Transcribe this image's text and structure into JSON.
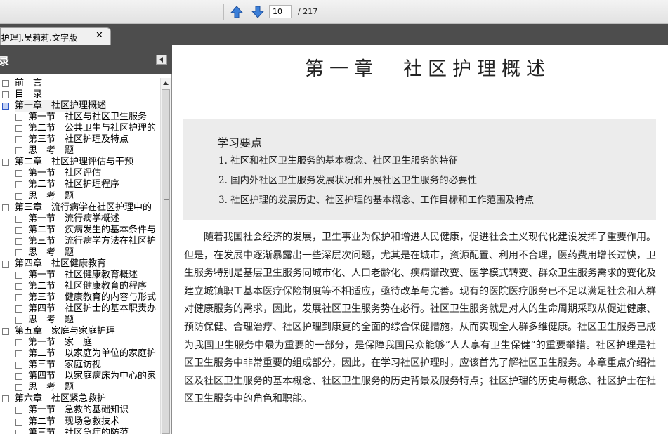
{
  "toolbar": {
    "page_current": "10",
    "page_total": "/ 217"
  },
  "tab": {
    "title": "[护理].吴莉莉.文字版",
    "close": "✕"
  },
  "toc": {
    "header": "录",
    "items": [
      {
        "label": "前　言",
        "level": 0
      },
      {
        "label": "目　录",
        "level": 0
      },
      {
        "label": "第一章　社区护理概述",
        "level": 0,
        "active": true
      },
      {
        "label": "第一节　社区与社区卫生服务",
        "level": 1
      },
      {
        "label": "第二节　公共卫生与社区护理的",
        "level": 1
      },
      {
        "label": "第三节　社区护理及特点",
        "level": 1
      },
      {
        "label": "思　考　题",
        "level": 1
      },
      {
        "label": "第二章　社区护理评估与干预",
        "level": 0
      },
      {
        "label": "第一节　社区评估",
        "level": 1
      },
      {
        "label": "第二节　社区护理程序",
        "level": 1
      },
      {
        "label": "思　考　题",
        "level": 1
      },
      {
        "label": "第三章　流行病学在社区护理中的",
        "level": 0
      },
      {
        "label": "第一节　流行病学概述",
        "level": 1
      },
      {
        "label": "第二节　疾病发生的基本条件与",
        "level": 1
      },
      {
        "label": "第三节　流行病学方法在社区护",
        "level": 1
      },
      {
        "label": "思　考　题",
        "level": 1
      },
      {
        "label": "第四章　社区健康教育",
        "level": 0
      },
      {
        "label": "第一节　社区健康教育概述",
        "level": 1
      },
      {
        "label": "第二节　社区健康教育的程序",
        "level": 1
      },
      {
        "label": "第三节　健康教育的内容与形式",
        "level": 1
      },
      {
        "label": "第四节　社区护士的基本职责办",
        "level": 1
      },
      {
        "label": "思　考　题",
        "level": 1
      },
      {
        "label": "第五章　家庭与家庭护理",
        "level": 0
      },
      {
        "label": "第一节　家　庭",
        "level": 1
      },
      {
        "label": "第二节　以家庭为单位的家庭护",
        "level": 1
      },
      {
        "label": "第三节　家庭访视",
        "level": 1
      },
      {
        "label": "第四节　以家庭病床为中心的家",
        "level": 1
      },
      {
        "label": "思　考　题",
        "level": 1
      },
      {
        "label": "第六章　社区紧急救护",
        "level": 0
      },
      {
        "label": "第一节　急救的基础知识",
        "level": 1
      },
      {
        "label": "第二节　现场急救技术",
        "level": 1
      },
      {
        "label": "第三节　社区急症的防范",
        "level": 1
      }
    ]
  },
  "document": {
    "chapter_title": "第一章　社区护理概述",
    "key_points_title": "学习要点",
    "key_points": [
      "1. 社区和社区卫生服务的基本概念、社区卫生服务的特征",
      "2. 国内外社区卫生服务发展状况和开展社区卫生服务的必要性",
      "3. 社区护理的发展历史、社区护理的基本概念、工作目标和工作范围及特点"
    ],
    "paragraph": "随着我国社会经济的发展，卫生事业为保护和增进人民健康，促进社会主义现代化建设发挥了重要作用。但是，在发展中逐渐暴露出一些深层次问题，尤其是在城市，资源配置、利用不合理，医药费用增长过快，卫生服务特别是基层卫生服务同城市化、人口老龄化、疾病谱改变、医学模式转变、群众卫生服务需求的变化及建立城镇职工基本医疗保险制度等不相适应，亟待改革与完善。现有的医院医疗服务已不足以满足社会和人群对健康服务的需求，因此，发展社区卫生服务势在必行。社区卫生服务就是对人的生命周期采取从促进健康、预防保健、合理治疗、社区护理到康复的全面的综合保健措施，从而实现全人群多维健康。社区卫生服务已成为我国卫生服务中最为重要的一部分，是保障我国民众能够“人人享有卫生保健”的重要举措。社区护理是社区卫生服务中非常重要的组成部分，因此，在学习社区护理时，应该首先了解社区卫生服务。本章重点介绍社区及社区卫生服务的基本概念、社区卫生服务的历史背景及服务特点；社区护理的历史与概念、社区护士在社区卫生服务中的角色和职能。"
  }
}
